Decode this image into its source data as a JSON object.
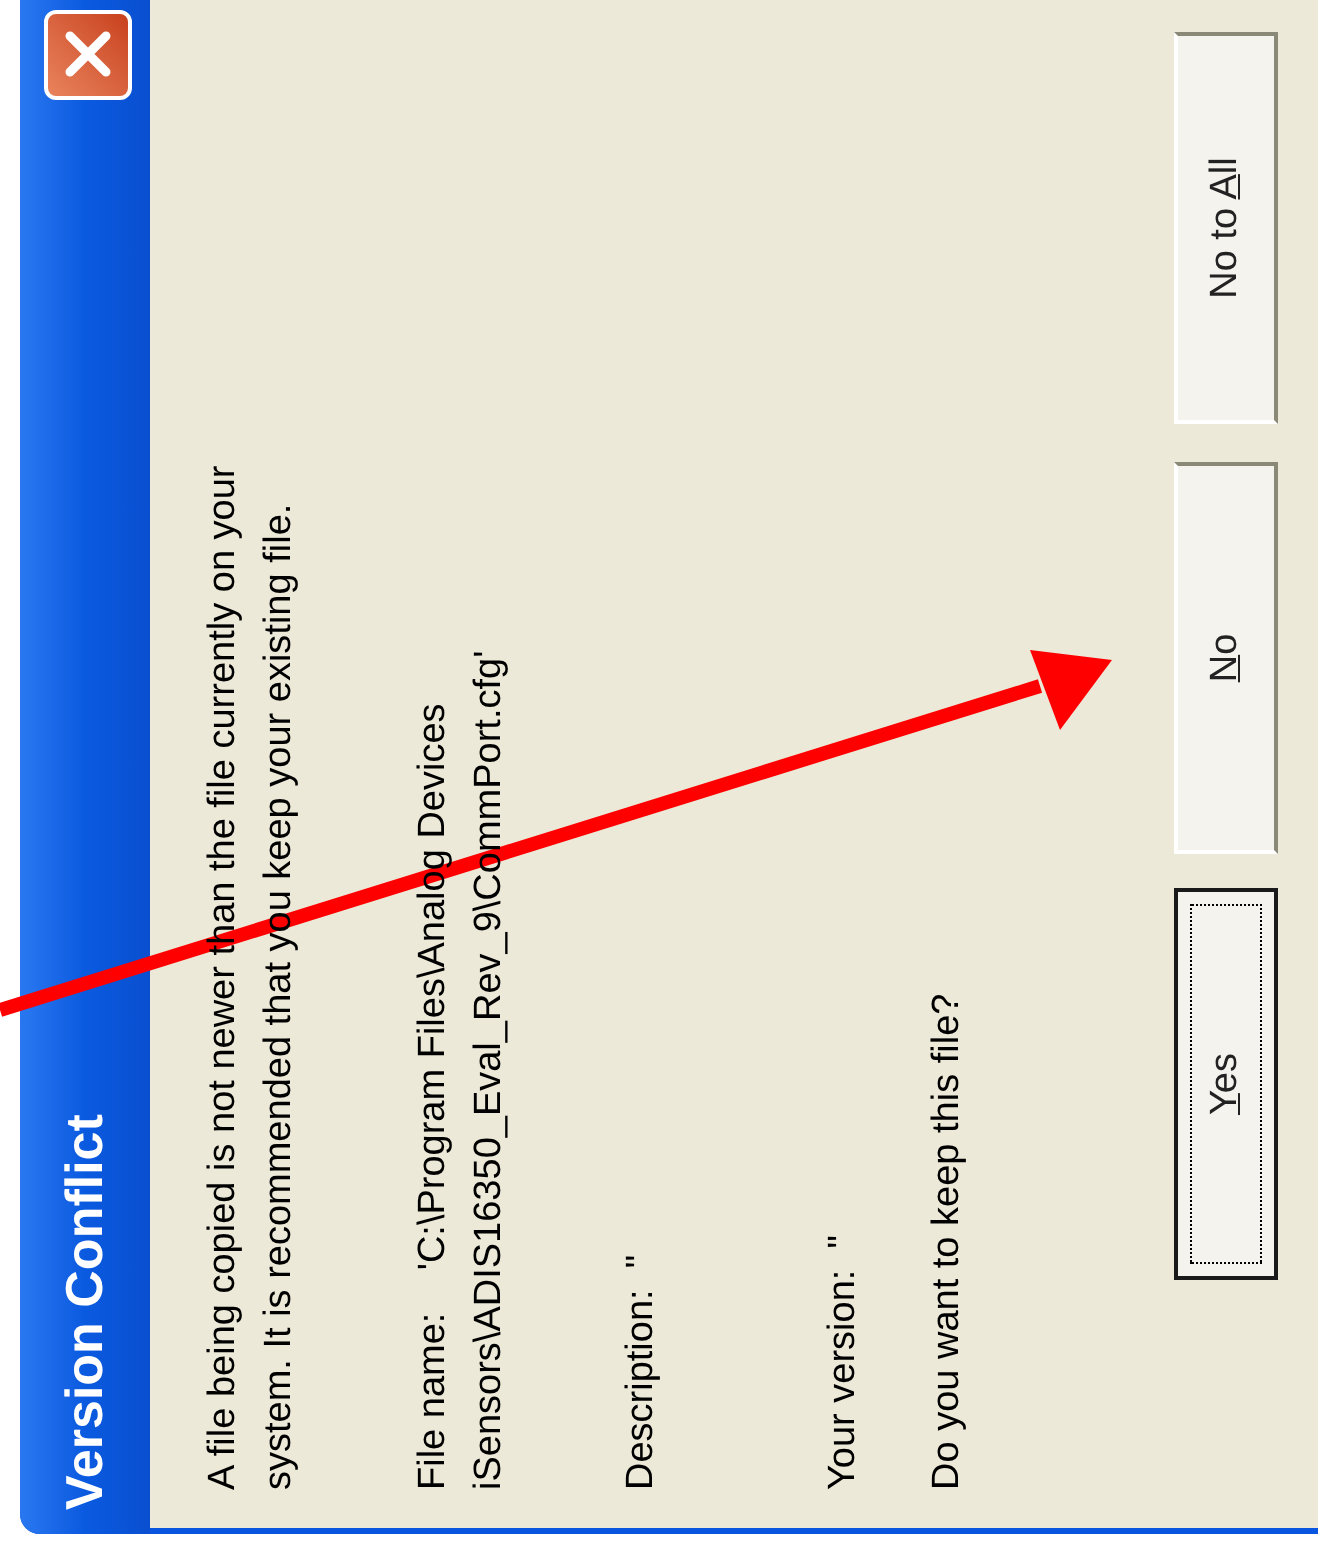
{
  "window": {
    "title": "Version Conflict"
  },
  "message": {
    "lines": [
      "A file being copied is not newer than the file currently on your",
      "system. It is recommended that you keep your existing file."
    ]
  },
  "file_name": {
    "lines": [
      "File name:    'C:\\Program Files\\Analog Devices",
      "iSensors\\ADIS16350_Eval_Rev_9\\CommPort.cfg'"
    ]
  },
  "description": "Description:  \"",
  "your_version": "Your version:  \"",
  "question": "Do you want to keep this file?",
  "buttons": [
    {
      "access_key": "Y",
      "after": "es",
      "selected": true
    },
    {
      "access_key": "N",
      "after": "o",
      "selected": false
    },
    {
      "before": "No to ",
      "access_key": "A",
      "after": "ll",
      "selected": false
    }
  ]
}
